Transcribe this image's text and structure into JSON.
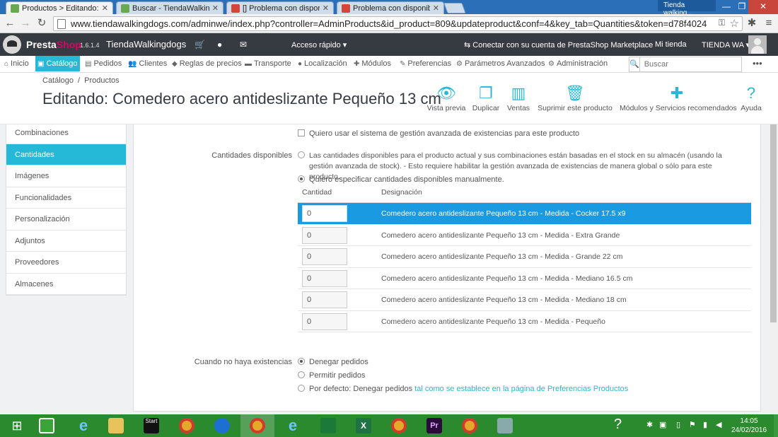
{
  "browser": {
    "tabs": [
      {
        "label": "Productos > Editando: Co",
        "favicon_color": "#6aa84f"
      },
      {
        "label": "Buscar - TiendaWalkingdo",
        "favicon_color": "#6aa84f"
      },
      {
        "label": "[] Problema con disponibil",
        "favicon_color": "#d44638"
      },
      {
        "label": "Problema con disponibilid",
        "favicon_color": "#d44638"
      }
    ],
    "profile": "Tienda walking...",
    "url": "www.tiendawalkingdogs.com/adminwe/index.php?controller=AdminProducts&id_product=809&updateproduct&conf=4&key_tab=Quantities&token=d78f4024"
  },
  "header": {
    "brand_presta": "Presta",
    "brand_shop": "Shop",
    "version": "1.6.1.4",
    "shop_name": "TiendaWalkingdogs",
    "quick_access": "Acceso rápido",
    "marketplace": "Conectar con su cuenta de PrestaShop Marketplace",
    "my_shop": "Mi tienda",
    "user": "TIENDA WA"
  },
  "nav": {
    "items": [
      {
        "label": "Inicio",
        "icon": "⌂"
      },
      {
        "label": "Catálogo",
        "icon": "▣"
      },
      {
        "label": "Pedidos",
        "icon": "▤"
      },
      {
        "label": "Clientes",
        "icon": "👥"
      },
      {
        "label": "Reglas de precios",
        "icon": "◆"
      },
      {
        "label": "Transporte",
        "icon": "▬"
      },
      {
        "label": "Localización",
        "icon": "●"
      },
      {
        "label": "Módulos",
        "icon": "✚"
      },
      {
        "label": "Preferencias",
        "icon": "✎"
      },
      {
        "label": "Parámetros Avanzados",
        "icon": "⚙"
      },
      {
        "label": "Administración",
        "icon": "⚙"
      }
    ],
    "search_placeholder": "Buscar"
  },
  "page": {
    "breadcrumb": [
      "Catálogo",
      "Productos"
    ],
    "title": "Editando: Comedero acero antideslizante Pequeño 13 cm",
    "toolbar": [
      {
        "label": "Vista previa",
        "icon": "👁"
      },
      {
        "label": "Duplicar",
        "icon": "❐"
      },
      {
        "label": "Ventas",
        "icon": "▥"
      },
      {
        "label": "Suprimir este producto",
        "icon": "🗑"
      },
      {
        "label": "Módulos y Servicios recomendados",
        "icon": "✚"
      },
      {
        "label": "Ayuda",
        "icon": "?"
      }
    ]
  },
  "sidebar": {
    "items": [
      "Combinaciones",
      "Cantidades",
      "Imágenes",
      "Funcionalidades",
      "Personalización",
      "Adjuntos",
      "Proveedores",
      "Almacenes"
    ],
    "active_index": 1
  },
  "quantities": {
    "advanced_stock": "Quiero usar el sistema de gestión avanzada de existencias para este producto",
    "available_label": "Cantidades disponibles",
    "option_stock": "Las cantidades disponibles para el producto actual y sus combinaciones están basadas en el stock en su almacén (usando la gestión avanzada de stock).  - Esto requiere habilitar la gestión avanzada de existencias de manera global o sólo para este producto.",
    "option_manual": "Quiero especificar cantidades disponibles manualmente.",
    "col_qty": "Cantidad",
    "col_desig": "Designación",
    "rows": [
      {
        "qty": "0",
        "designation": "Comedero acero antideslizante Pequeño 13 cm - Medida - Cocker 17.5 x9"
      },
      {
        "qty": "0",
        "designation": "Comedero acero antideslizante Pequeño 13 cm - Medida - Extra Grande"
      },
      {
        "qty": "0",
        "designation": "Comedero acero antideslizante Pequeño 13 cm - Medida - Grande 22 cm"
      },
      {
        "qty": "0",
        "designation": "Comedero acero antideslizante Pequeño 13 cm - Medida - Mediano 16.5 cm"
      },
      {
        "qty": "0",
        "designation": "Comedero acero antideslizante Pequeño 13 cm - Medida - Mediano 18 cm"
      },
      {
        "qty": "0",
        "designation": "Comedero acero antideslizante Pequeño 13 cm - Medida - Pequeño"
      }
    ],
    "selected_row": 0,
    "out_of_stock_label": "Cuando no haya existencias",
    "deny": "Denegar pedidos",
    "allow": "Permitir pedidos",
    "default_prefix": "Por defecto: Denegar pedidos",
    "default_link": "tal como se establece en la página de Preferencias Productos"
  },
  "taskbar": {
    "start_tile": "Start",
    "time": "14:05",
    "date": "24/02/2016"
  }
}
